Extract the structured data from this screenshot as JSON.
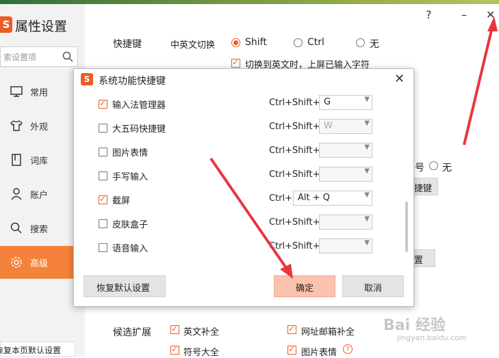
{
  "app": {
    "title": "属性设置",
    "logo": "S"
  },
  "search": {
    "placeholder": "索设置项"
  },
  "sidebar": {
    "items": [
      {
        "label": "常用",
        "icon": "monitor-icon"
      },
      {
        "label": "外观",
        "icon": "shirt-icon"
      },
      {
        "label": "词库",
        "icon": "book-icon"
      },
      {
        "label": "账户",
        "icon": "user-icon"
      },
      {
        "label": "搜索",
        "icon": "search-icon"
      },
      {
        "label": "高级",
        "icon": "gear-icon",
        "active": true
      }
    ],
    "reset_label": "恢复本页默认设置"
  },
  "window": {
    "help": "?",
    "minimize": "–",
    "close": "✕"
  },
  "main": {
    "hotkey_label": "快捷键",
    "cn_en_switch_label": "中英文切换",
    "switch_options": [
      "Shift",
      "Ctrl",
      "无"
    ],
    "switch_selected": "Shift",
    "commit_on_switch_label": "切换到英文时，上屏已输入字符",
    "partial_hao": "号",
    "partial_wu": "无",
    "partial_btn1": "捷键",
    "partial_btn2": "置",
    "candidate_ext_label": "候选扩展",
    "candidate_options": [
      {
        "label": "英文补全",
        "checked": true
      },
      {
        "label": "网址邮箱补全",
        "checked": true
      },
      {
        "label": "符号大全",
        "checked": true
      },
      {
        "label": "图片表情",
        "checked": true
      }
    ]
  },
  "dialog": {
    "title": "系统功能快捷键",
    "close": "✕",
    "rows": [
      {
        "label": "输入法管理器",
        "checked": true,
        "modifier": "Ctrl+Shift+",
        "key": "G",
        "enabled": true
      },
      {
        "label": "大五码快捷键",
        "checked": false,
        "modifier": "Ctrl+Shift+",
        "key": "W",
        "enabled": false
      },
      {
        "label": "图片表情",
        "checked": false,
        "modifier": "Ctrl+Shift+",
        "key": "",
        "enabled": false
      },
      {
        "label": "手写输入",
        "checked": false,
        "modifier": "Ctrl+Shift+",
        "key": "",
        "enabled": false
      },
      {
        "label": "截屏",
        "checked": true,
        "modifier": "Ctrl+",
        "key": "Alt + Q",
        "enabled": true
      },
      {
        "label": "皮肤盒子",
        "checked": false,
        "modifier": "Ctrl+Shift+",
        "key": "",
        "enabled": false
      },
      {
        "label": "语音输入",
        "checked": false,
        "modifier": "Ctrl+Shift+",
        "key": "",
        "enabled": false
      }
    ],
    "restore_label": "恢复默认设置",
    "ok_label": "确定",
    "cancel_label": "取消"
  },
  "watermark": {
    "brand": "Bai 经验",
    "url": "jingyan.baidu.com"
  },
  "colors": {
    "accent": "#f5823a",
    "brand": "#f05a23",
    "arrow": "#e8373c",
    "ok_button": "#fbc2ae"
  }
}
